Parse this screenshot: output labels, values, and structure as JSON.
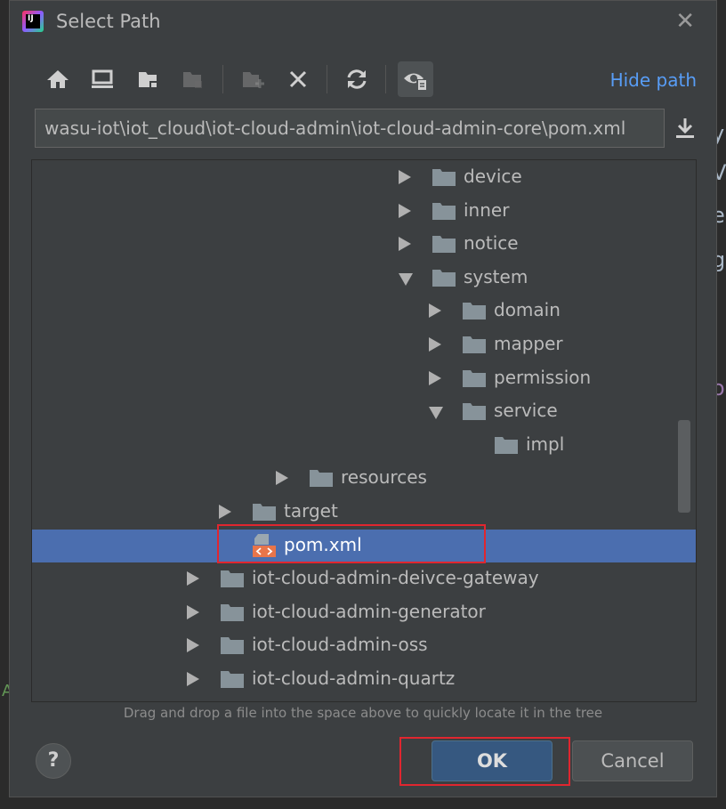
{
  "dialog": {
    "title": "Select Path"
  },
  "toolbar": {
    "buttons": [
      {
        "icon": "home-icon",
        "enabled": true
      },
      {
        "icon": "desktop-icon",
        "enabled": true
      },
      {
        "icon": "project-folder-icon",
        "enabled": true
      },
      {
        "icon": "module-folder-icon",
        "enabled": false
      },
      {
        "icon": "new-folder-icon",
        "enabled": false
      },
      {
        "icon": "delete-icon",
        "enabled": true
      },
      {
        "icon": "refresh-icon",
        "enabled": true
      },
      {
        "icon": "show-hidden-icon",
        "enabled": true,
        "active": true
      }
    ],
    "hide_path_label": "Hide path"
  },
  "path": {
    "value": "wasu-iot\\iot_cloud\\iot-cloud-admin\\iot-cloud-admin-core\\pom.xml"
  },
  "tree": {
    "rows": [
      {
        "label": "device",
        "arrow": "right",
        "icon": "folder"
      },
      {
        "label": "inner",
        "arrow": "right",
        "icon": "folder"
      },
      {
        "label": "notice",
        "arrow": "right",
        "icon": "folder"
      },
      {
        "label": "system",
        "arrow": "down",
        "icon": "folder"
      },
      {
        "label": "domain",
        "arrow": "right",
        "icon": "folder"
      },
      {
        "label": "mapper",
        "arrow": "right",
        "icon": "folder"
      },
      {
        "label": "permission",
        "arrow": "right",
        "icon": "folder"
      },
      {
        "label": "service",
        "arrow": "down",
        "icon": "folder"
      },
      {
        "label": "impl",
        "arrow": "none",
        "icon": "folder"
      },
      {
        "label": "resources",
        "arrow": "right",
        "icon": "folder"
      },
      {
        "label": "target",
        "arrow": "right",
        "icon": "folder"
      },
      {
        "label": "pom.xml",
        "arrow": "none",
        "icon": "xml",
        "selected": true
      },
      {
        "label": "iot-cloud-admin-deivce-gateway",
        "arrow": "right",
        "icon": "folder"
      },
      {
        "label": "iot-cloud-admin-generator",
        "arrow": "right",
        "icon": "folder"
      },
      {
        "label": "iot-cloud-admin-oss",
        "arrow": "right",
        "icon": "folder"
      },
      {
        "label": "iot-cloud-admin-quartz",
        "arrow": "right",
        "icon": "folder"
      }
    ]
  },
  "hint": "Drag and drop a file into the space above to quickly locate it in the tree",
  "buttons": {
    "help": "?",
    "ok": "OK",
    "cancel": "Cancel"
  },
  "colors": {
    "selection": "#4b6eaf",
    "link": "#589df6",
    "highlight": "#e0262f",
    "ok_button": "#365880"
  },
  "backdrop": [
    "y",
    "V",
    "e",
    "g",
    ".",
    "o",
    "A"
  ]
}
